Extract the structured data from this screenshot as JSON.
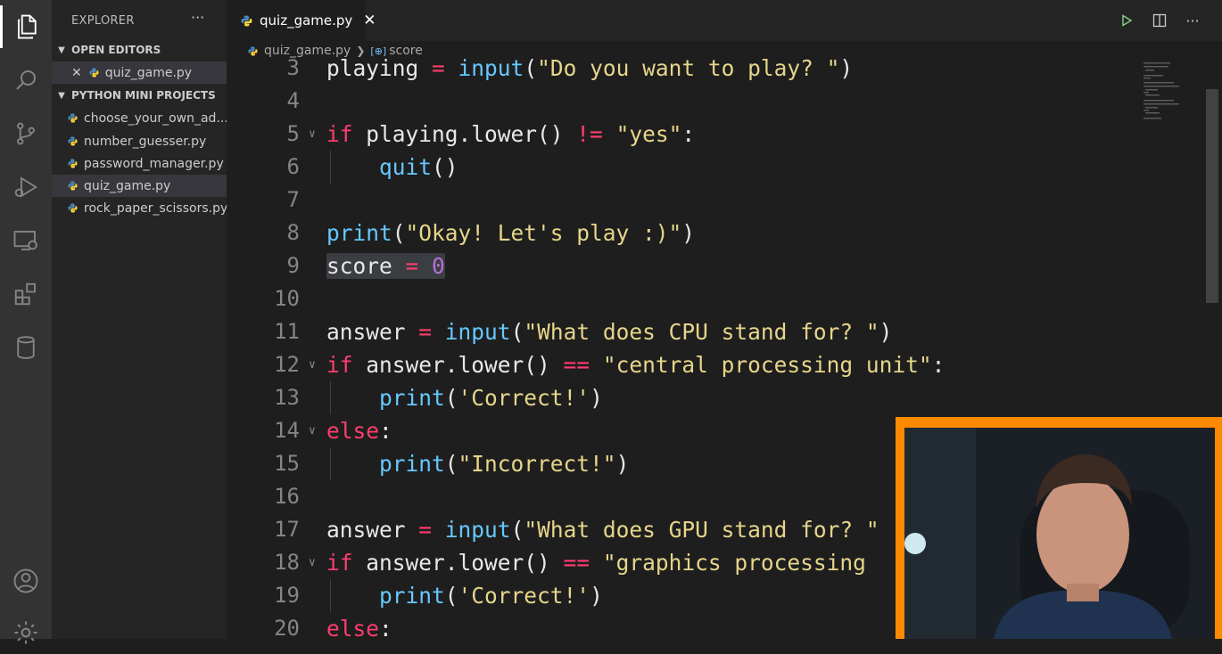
{
  "explorer": {
    "title": "EXPLORER",
    "more": "···",
    "open_editors": {
      "label": "OPEN EDITORS",
      "items": [
        {
          "name": "quiz_game.py"
        }
      ]
    },
    "project": {
      "label": "PYTHON MINI PROJECTS",
      "files": [
        {
          "name": "choose_your_own_ad..."
        },
        {
          "name": "number_guesser.py"
        },
        {
          "name": "password_manager.py"
        },
        {
          "name": "quiz_game.py",
          "selected": true
        },
        {
          "name": "rock_paper_scissors.py"
        }
      ]
    }
  },
  "editor": {
    "tab": {
      "label": "quiz_game.py",
      "close": "✕"
    },
    "breadcrumb": {
      "file": "quiz_game.py",
      "symbol": "score"
    },
    "lines": [
      {
        "n": "3",
        "text": "playing = input(\"Do you want to play? \")"
      },
      {
        "n": "4",
        "text": ""
      },
      {
        "n": "5",
        "text": "if playing.lower() != \"yes\":"
      },
      {
        "n": "6",
        "text": "    quit()"
      },
      {
        "n": "7",
        "text": ""
      },
      {
        "n": "8",
        "text": "print(\"Okay! Let's play :)\")"
      },
      {
        "n": "9",
        "text": "score = 0"
      },
      {
        "n": "10",
        "text": ""
      },
      {
        "n": "11",
        "text": "answer = input(\"What does CPU stand for? \")"
      },
      {
        "n": "12",
        "text": "if answer.lower() == \"central processing unit\":"
      },
      {
        "n": "13",
        "text": "    print('Correct!')"
      },
      {
        "n": "14",
        "text": "else:"
      },
      {
        "n": "15",
        "text": "    print(\"Incorrect!\")"
      },
      {
        "n": "16",
        "text": ""
      },
      {
        "n": "17",
        "text": "answer = input(\"What does GPU stand for? \""
      },
      {
        "n": "18",
        "text": "if answer.lower() == \"graphics processing"
      },
      {
        "n": "19",
        "text": "    print('Correct!')"
      },
      {
        "n": "20",
        "text": "else:"
      }
    ]
  },
  "colors": {
    "keyword": "#ff3d6e",
    "function": "#66c8ff",
    "string": "#e6d58a",
    "number": "#b66fd6",
    "webcam_frame": "#ff8a00"
  },
  "icons": {
    "activity": [
      "files-icon",
      "search-icon",
      "source-control-icon",
      "run-debug-icon",
      "remote-explorer-icon",
      "extensions-icon",
      "database-icon",
      "account-icon",
      "settings-gear-icon"
    ],
    "editor_actions": [
      "run-icon",
      "split-editor-icon",
      "more-actions-icon"
    ]
  }
}
